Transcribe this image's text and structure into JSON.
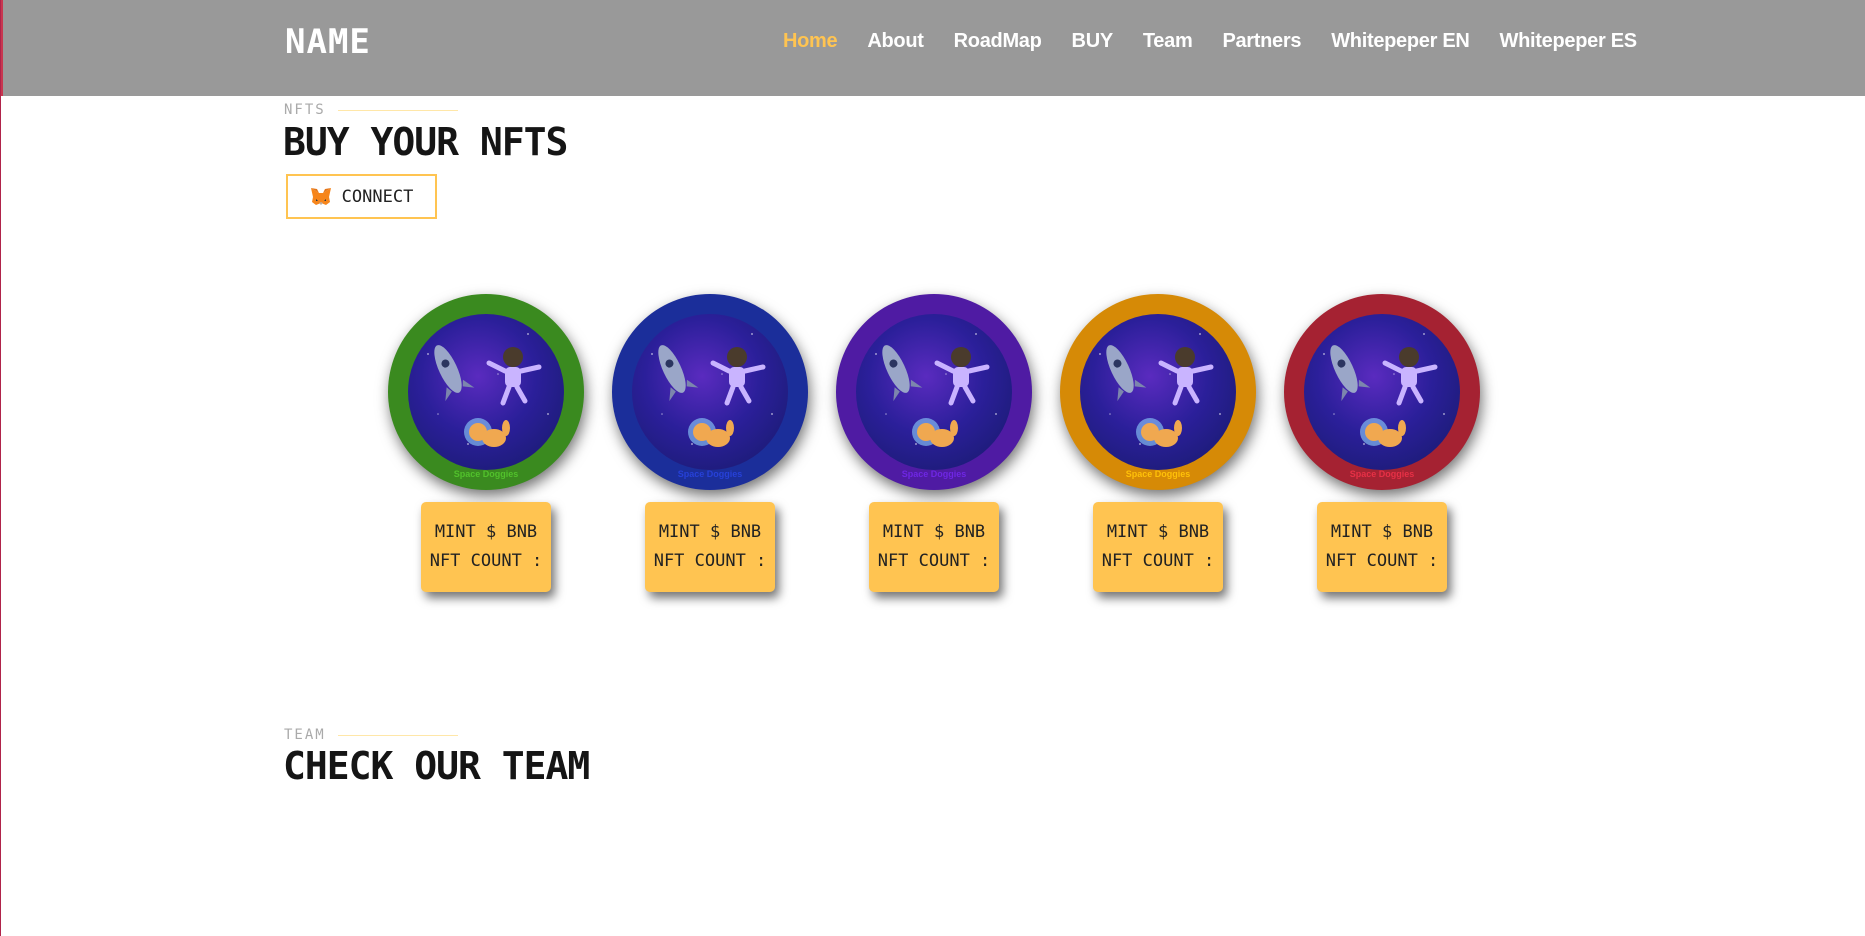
{
  "header": {
    "logo": "NAME",
    "nav": [
      {
        "label": "Home",
        "active": true
      },
      {
        "label": "About"
      },
      {
        "label": "RoadMap"
      },
      {
        "label": "BUY"
      },
      {
        "label": "Team"
      },
      {
        "label": "Partners"
      },
      {
        "label": "Whitepeper EN"
      },
      {
        "label": "Whitepeper ES"
      }
    ]
  },
  "nfts": {
    "label": "NFTS",
    "title": "BUY YOUR NFTS",
    "connect_label": "CONNECT",
    "cards": [
      {
        "color": "#3a8a1f",
        "coin_text": "Space Doggies",
        "mint": "MINT $ BNB",
        "count": "NFT COUNT :"
      },
      {
        "color": "#1b2e9a",
        "coin_text": "Space Doggies",
        "mint": "MINT $ BNB",
        "count": "NFT COUNT :"
      },
      {
        "color": "#4f1ba3",
        "coin_text": "Space Doggies",
        "mint": "MINT $ BNB",
        "count": "NFT COUNT :"
      },
      {
        "color": "#d68a06",
        "coin_text": "Space Doggies",
        "mint": "MINT $ BNB",
        "count": "NFT COUNT :"
      },
      {
        "color": "#a52232",
        "coin_text": "Space Doggies",
        "mint": "MINT $ BNB",
        "count": "NFT COUNT :"
      }
    ]
  },
  "team": {
    "label": "TEAM",
    "title": "CHECK OUR TEAM"
  },
  "colors": {
    "header_bg": "#999999",
    "accent": "#ffc451"
  }
}
